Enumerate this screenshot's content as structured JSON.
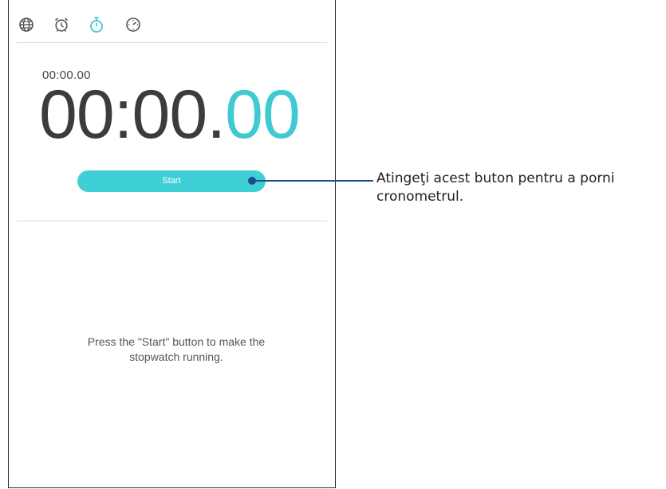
{
  "tabs": [
    {
      "icon": "globe-icon",
      "active": false
    },
    {
      "icon": "alarm-clock-icon",
      "active": false
    },
    {
      "icon": "stopwatch-icon",
      "active": true
    },
    {
      "icon": "timer-icon",
      "active": false
    }
  ],
  "stopwatch": {
    "small_time": "00:00.00",
    "big_time_main": "00:00.",
    "big_time_ms": "00",
    "start_label": "Start",
    "hint_line1": "Press the \"Start\" button to make the",
    "hint_line2": "stopwatch running."
  },
  "callout": {
    "line1": "Atingeţi acest buton pentru a porni",
    "line2": "cronometrul."
  },
  "colors": {
    "accent": "#3ED0D4",
    "callout": "#1B4F8C"
  }
}
